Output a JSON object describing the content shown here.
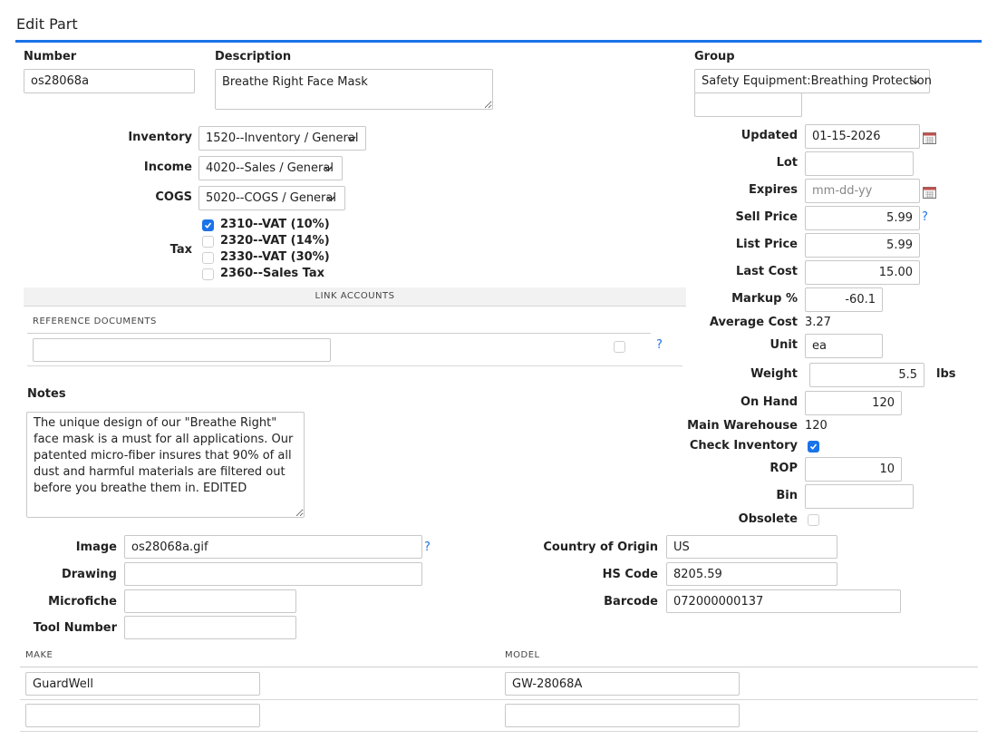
{
  "page": {
    "title": "Edit Part",
    "accent": "#1a73e8"
  },
  "number": {
    "label": "Number",
    "value": "os28068a"
  },
  "description": {
    "label": "Description",
    "value": "Breathe Right Face Mask"
  },
  "group": {
    "label": "Group",
    "value": "Safety Equipment:Breathing Protection",
    "extra_value": ""
  },
  "accounts": {
    "inventory": {
      "label": "Inventory",
      "value": "1520--Inventory / General"
    },
    "income": {
      "label": "Income",
      "value": "4020--Sales / General"
    },
    "cogs": {
      "label": "COGS",
      "value": "5020--COGS / General"
    }
  },
  "tax": {
    "label": "Tax",
    "options": [
      {
        "label": "2310--VAT (10%)",
        "checked": true
      },
      {
        "label": "2320--VAT (14%)",
        "checked": false
      },
      {
        "label": "2330--VAT (30%)",
        "checked": false
      },
      {
        "label": "2360--Sales Tax",
        "checked": false
      }
    ]
  },
  "link_accounts": {
    "label": "LINK ACCOUNTS"
  },
  "reference_documents": {
    "label": "REFERENCE DOCUMENTS",
    "value": "",
    "checked": false,
    "help": "?"
  },
  "notes": {
    "label": "Notes",
    "value": "The unique design of our \"Breathe Right\" face mask is a must for all applications. Our patented micro-fiber insures that 90% of all dust and harmful materials are filtered out before you breathe them in. EDITED"
  },
  "right": {
    "updated": {
      "label": "Updated",
      "value": "01-15-2026"
    },
    "lot": {
      "label": "Lot",
      "value": ""
    },
    "expires": {
      "label": "Expires",
      "value": "",
      "placeholder": "mm-dd-yy"
    },
    "sell_price": {
      "label": "Sell Price",
      "value": "5.99",
      "help": "?"
    },
    "list_price": {
      "label": "List Price",
      "value": "5.99"
    },
    "last_cost": {
      "label": "Last Cost",
      "value": "15.00"
    },
    "markup": {
      "label": "Markup %",
      "value": "-60.1"
    },
    "average_cost": {
      "label": "Average Cost",
      "value": "3.27"
    },
    "unit": {
      "label": "Unit",
      "value": "ea"
    },
    "weight": {
      "label": "Weight",
      "value": "5.5",
      "unit": "lbs"
    },
    "on_hand": {
      "label": "On Hand",
      "value": "120"
    },
    "main_warehouse": {
      "label": "Main Warehouse",
      "value": "120"
    },
    "check_inventory": {
      "label": "Check Inventory",
      "checked": true
    },
    "rop": {
      "label": "ROP",
      "value": "10"
    },
    "bin": {
      "label": "Bin",
      "value": ""
    },
    "obsolete": {
      "label": "Obsolete",
      "checked": false
    }
  },
  "image": {
    "label": "Image",
    "value": "os28068a.gif",
    "help": "?"
  },
  "drawing": {
    "label": "Drawing",
    "value": ""
  },
  "microfiche": {
    "label": "Microfiche",
    "value": ""
  },
  "tool_number": {
    "label": "Tool Number",
    "value": ""
  },
  "country_of_origin": {
    "label": "Country of Origin",
    "value": "US"
  },
  "hs_code": {
    "label": "HS Code",
    "value": "8205.59"
  },
  "barcode": {
    "label": "Barcode",
    "value": "072000000137"
  },
  "make_model": {
    "make_label": "MAKE",
    "model_label": "MODEL",
    "rows": [
      {
        "make": "GuardWell",
        "model": "GW-28068A"
      },
      {
        "make": "",
        "model": ""
      }
    ]
  }
}
